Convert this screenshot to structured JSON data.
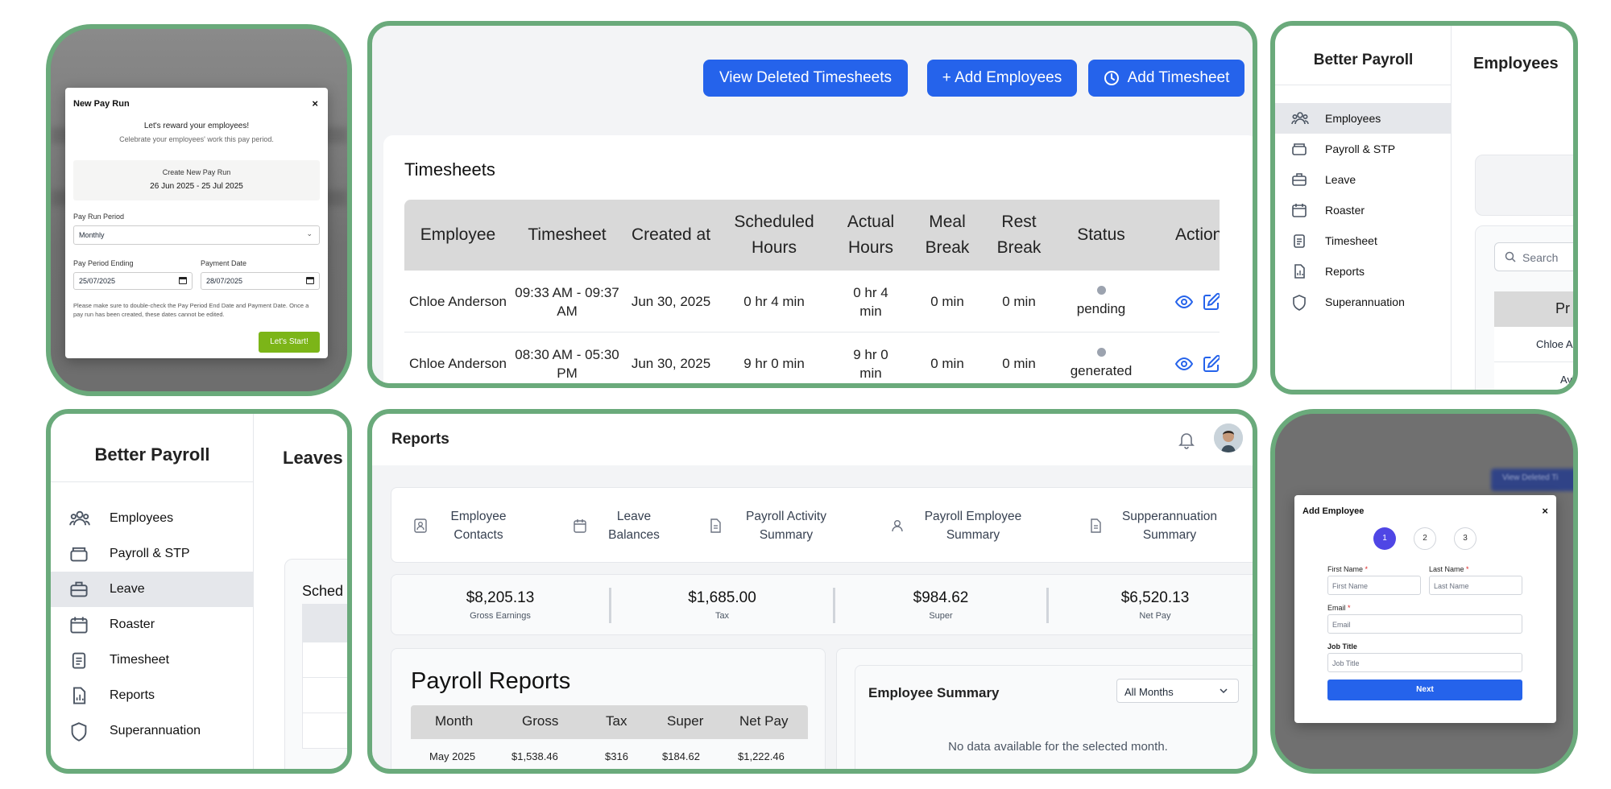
{
  "pay_run_modal": {
    "title": "New Pay Run",
    "close": "×",
    "heading": "Let's reward your employees!",
    "subheading": "Celebrate your employees' work this pay period.",
    "create_label": "Create New Pay Run",
    "period_range": "26 Jun 2025 - 25 Jul 2025",
    "period_label": "Pay Run Period",
    "period_value": "Monthly",
    "ending_label": "Pay Period Ending",
    "ending_value": "25/07/2025",
    "payment_label": "Payment Date",
    "payment_value": "28/07/2025",
    "note": "Please make sure to double-check the Pay Period End Date and Payment Date. Once a pay run has been created, these dates cannot be edited.",
    "start_button": "Let's Start!"
  },
  "timesheets": {
    "btn_deleted": "View Deleted Timesheets",
    "btn_add_employees": "+ Add Employees",
    "btn_add_timesheet": "Add Timesheet",
    "title": "Timesheets",
    "columns": [
      "Employee",
      "Timesheet",
      "Created at",
      "Scheduled Hours",
      "Actual Hours",
      "Meal Break",
      "Rest Break",
      "Status",
      "Actions"
    ],
    "rows": [
      {
        "employee": "Chloe Anderson",
        "timesheet": "09:33 AM - 09:37 AM",
        "created": "Jun 30, 2025",
        "scheduled": "0 hr 4 min",
        "actual": "0 hr 4 min",
        "meal": "0 min",
        "rest": "0 min",
        "status": "pending"
      },
      {
        "employee": "Chloe Anderson",
        "timesheet": "08:30 AM - 05:30 PM",
        "created": "Jun 30, 2025",
        "scheduled": "9 hr 0 min",
        "actual": "9 hr 0 min",
        "meal": "0 min",
        "rest": "0 min",
        "status": "generated"
      }
    ]
  },
  "sidebar_small": {
    "brand": "Better Payroll",
    "items": [
      "Employees",
      "Payroll & STP",
      "Leave",
      "Roaster",
      "Timesheet",
      "Reports",
      "Superannuation"
    ],
    "active": "Employees",
    "page_title": "Employees",
    "search_placeholder": "Search",
    "column_partial": "Pr",
    "row1": "Chloe A",
    "row2": "Ayaa"
  },
  "sidebar_large": {
    "brand": "Better Payroll",
    "items": [
      "Employees",
      "Payroll & STP",
      "Leave",
      "Roaster",
      "Timesheet",
      "Reports",
      "Superannuation"
    ],
    "active": "Leave",
    "page_title": "Leaves",
    "section_partial": "Sched"
  },
  "reports": {
    "title": "Reports",
    "tabs": [
      "Employee Contacts",
      "Leave Balances",
      "Payroll Activity Summary",
      "Payroll Employee Summary",
      "Supperannuation Summary"
    ],
    "stats": [
      {
        "value": "$8,205.13",
        "label": "Gross Earnings"
      },
      {
        "value": "$1,685.00",
        "label": "Tax"
      },
      {
        "value": "$984.62",
        "label": "Super"
      },
      {
        "value": "$6,520.13",
        "label": "Net Pay"
      }
    ],
    "payroll_title": "Payroll Reports",
    "payroll_columns": [
      "Month",
      "Gross",
      "Tax",
      "Super",
      "Net Pay"
    ],
    "payroll_row": [
      "May 2025",
      "$1,538.46",
      "$316",
      "$184.62",
      "$1,222.46"
    ],
    "summary_title": "Employee Summary",
    "summary_filter": "All Months",
    "summary_empty": "No data available for the selected month."
  },
  "add_employee_modal": {
    "background_button": "View Deleted Ti",
    "title": "Add Employee",
    "close": "×",
    "steps": [
      "1",
      "2",
      "3"
    ],
    "first_name_label": "First Name",
    "first_name_placeholder": "First Name",
    "last_name_label": "Last Name",
    "last_name_placeholder": "Last Name",
    "email_label": "Email",
    "email_placeholder": "Email",
    "job_label": "Job Title",
    "job_placeholder": "Job Title",
    "required_mark": "*",
    "next_button": "Next"
  },
  "colors": {
    "panel_border": "#6aaa7b",
    "primary": "#2563eb",
    "pay_run_start": "#7cb518",
    "step_active": "#4f46e5",
    "required": "#dc2626"
  }
}
